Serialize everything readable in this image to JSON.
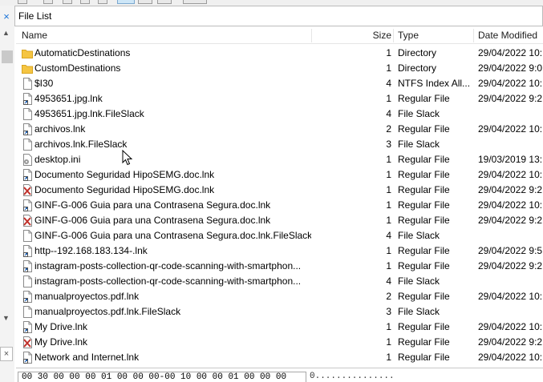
{
  "panel": {
    "title": "File List"
  },
  "columns": {
    "name": "Name",
    "size": "Size",
    "type": "Type",
    "date": "Date Modified"
  },
  "close_glyph": "×",
  "rows": [
    {
      "icon": "folder-icon",
      "name": "AutomaticDestinations",
      "size": "1",
      "type": "Directory",
      "date": "29/04/2022 10:..."
    },
    {
      "icon": "folder-icon",
      "name": "CustomDestinations",
      "size": "1",
      "type": "Directory",
      "date": "29/04/2022 9:0..."
    },
    {
      "icon": "file-icon",
      "name": "$I30",
      "size": "4",
      "type": "NTFS Index All...",
      "date": "29/04/2022 10:..."
    },
    {
      "icon": "shortcut-file-icon",
      "name": "4953651.jpg.lnk",
      "size": "1",
      "type": "Regular File",
      "date": "29/04/2022 9:2..."
    },
    {
      "icon": "file-icon",
      "name": "4953651.jpg.lnk.FileSlack",
      "size": "4",
      "type": "File Slack",
      "date": ""
    },
    {
      "icon": "shortcut-file-icon",
      "name": "archivos.lnk",
      "size": "2",
      "type": "Regular File",
      "date": "29/04/2022 10:..."
    },
    {
      "icon": "file-icon",
      "name": "archivos.lnk.FileSlack",
      "size": "3",
      "type": "File Slack",
      "date": ""
    },
    {
      "icon": "settings-file-icon",
      "name": "desktop.ini",
      "size": "1",
      "type": "Regular File",
      "date": "19/03/2019 13:..."
    },
    {
      "icon": "shortcut-file-icon",
      "name": "Documento Seguridad HipoSEMG.doc.lnk",
      "size": "1",
      "type": "Regular File",
      "date": "29/04/2022 10:..."
    },
    {
      "icon": "deleted-file-icon",
      "name": "Documento Seguridad HipoSEMG.doc.lnk",
      "size": "1",
      "type": "Regular File",
      "date": "29/04/2022 9:2..."
    },
    {
      "icon": "shortcut-file-icon",
      "name": "GINF-G-006 Guia para una Contrasena Segura.doc.lnk",
      "size": "1",
      "type": "Regular File",
      "date": "29/04/2022 10:..."
    },
    {
      "icon": "deleted-file-icon",
      "name": "GINF-G-006 Guia para una Contrasena Segura.doc.lnk",
      "size": "1",
      "type": "Regular File",
      "date": "29/04/2022 9:2..."
    },
    {
      "icon": "file-icon",
      "name": "GINF-G-006 Guia para una Contrasena Segura.doc.lnk.FileSlack",
      "size": "4",
      "type": "File Slack",
      "date": ""
    },
    {
      "icon": "shortcut-file-icon",
      "name": "http--192.168.183.134-.lnk",
      "size": "1",
      "type": "Regular File",
      "date": "29/04/2022 9:5..."
    },
    {
      "icon": "shortcut-file-icon",
      "name": "instagram-posts-collection-qr-code-scanning-with-smartphon...",
      "size": "1",
      "type": "Regular File",
      "date": "29/04/2022 9:2..."
    },
    {
      "icon": "file-icon",
      "name": "instagram-posts-collection-qr-code-scanning-with-smartphon...",
      "size": "4",
      "type": "File Slack",
      "date": ""
    },
    {
      "icon": "shortcut-file-icon",
      "name": "manualproyectos.pdf.lnk",
      "size": "2",
      "type": "Regular File",
      "date": "29/04/2022 10:..."
    },
    {
      "icon": "file-icon",
      "name": "manualproyectos.pdf.lnk.FileSlack",
      "size": "3",
      "type": "File Slack",
      "date": ""
    },
    {
      "icon": "shortcut-file-icon",
      "name": "My Drive.lnk",
      "size": "1",
      "type": "Regular File",
      "date": "29/04/2022 10:..."
    },
    {
      "icon": "deleted-file-icon",
      "name": "My Drive.lnk",
      "size": "1",
      "type": "Regular File",
      "date": "29/04/2022 9:2..."
    },
    {
      "icon": "shortcut-file-icon",
      "name": "Network and Internet.lnk",
      "size": "1",
      "type": "Regular File",
      "date": "29/04/2022 10:..."
    }
  ],
  "hex": {
    "bytes": "00 30 00 00 00 01 00 00 00-00 10 00 00 01 00 00 00",
    "ascii": "0..............."
  },
  "colors": {
    "folder": "#f5c542",
    "deleted_mark": "#c0302a",
    "accent": "#1a73d9"
  }
}
